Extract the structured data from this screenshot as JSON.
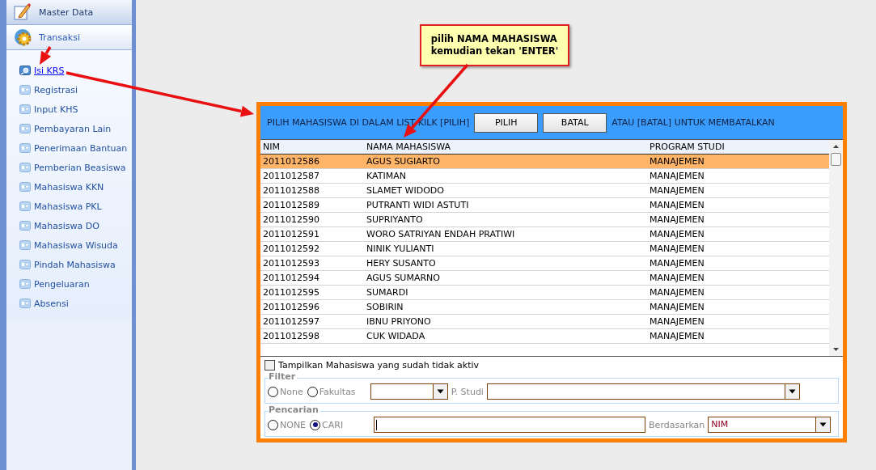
{
  "sidebar": {
    "groups": [
      {
        "label": "Master Data",
        "expanded": false
      },
      {
        "label": "Transaksi",
        "expanded": true
      }
    ],
    "items": [
      {
        "label": "Isi KRS",
        "selected": true
      },
      {
        "label": "Registrasi",
        "selected": false
      },
      {
        "label": "Input KHS",
        "selected": false
      },
      {
        "label": "Pembayaran Lain",
        "selected": false
      },
      {
        "label": "Penerimaan Bantuan",
        "selected": false
      },
      {
        "label": "Pemberian Beasiswa",
        "selected": false
      },
      {
        "label": "Mahasiswa KKN",
        "selected": false
      },
      {
        "label": "Mahasiswa PKL",
        "selected": false
      },
      {
        "label": "Mahasiswa DO",
        "selected": false
      },
      {
        "label": "Mahasiswa Wisuda",
        "selected": false
      },
      {
        "label": "Pindah Mahasiswa",
        "selected": false
      },
      {
        "label": "Pengeluaran",
        "selected": false
      },
      {
        "label": "Absensi",
        "selected": false
      }
    ]
  },
  "callout": {
    "lines": [
      "pilih NAMA MAHASISWA",
      "kemudian tekan 'ENTER'"
    ]
  },
  "dialog": {
    "instruction_left": "PILIH MAHASISWA DI DALAM LIST KILK [PILIH]",
    "buttons": [
      "PILIH",
      "BATAL"
    ],
    "instruction_right": "ATAU [BATAL] UNTUK MEMBATALKAN",
    "table": {
      "columns": [
        "NIM",
        "NAMA MAHASISWA",
        "PROGRAM STUDI"
      ],
      "rows": [
        {
          "cells": [
            "2011012586",
            "AGUS SUGIARTO",
            "MANAJEMEN"
          ],
          "selected": true
        },
        {
          "cells": [
            "2011012587",
            "KATIMAN",
            "MANAJEMEN"
          ],
          "selected": false
        },
        {
          "cells": [
            "2011012588",
            "SLAMET WIDODO",
            "MANAJEMEN"
          ],
          "selected": false
        },
        {
          "cells": [
            "2011012589",
            "PUTRANTI WIDI ASTUTI",
            "MANAJEMEN"
          ],
          "selected": false
        },
        {
          "cells": [
            "2011012590",
            "SUPRIYANTO",
            "MANAJEMEN"
          ],
          "selected": false
        },
        {
          "cells": [
            "2011012591",
            "WORO SATRIYAN ENDAH PRATIWI",
            "MANAJEMEN"
          ],
          "selected": false
        },
        {
          "cells": [
            "2011012592",
            "NINIK YULIANTI",
            "MANAJEMEN"
          ],
          "selected": false
        },
        {
          "cells": [
            "2011012593",
            "HERY SUSANTO",
            "MANAJEMEN"
          ],
          "selected": false
        },
        {
          "cells": [
            "2011012594",
            "AGUS SUMARNO",
            "MANAJEMEN"
          ],
          "selected": false
        },
        {
          "cells": [
            "2011012595",
            "SUMARDI",
            "MANAJEMEN"
          ],
          "selected": false
        },
        {
          "cells": [
            "2011012596",
            "SOBIRIN",
            "MANAJEMEN"
          ],
          "selected": false
        },
        {
          "cells": [
            "2011012597",
            "IBNU PRIYONO",
            "MANAJEMEN"
          ],
          "selected": false
        },
        {
          "cells": [
            "2011012598",
            "CUK WIDADA",
            "MANAJEMEN"
          ],
          "selected": false
        }
      ]
    },
    "inactive_checkbox": {
      "label": "Tampilkan Mahasiswa yang sudah tidak aktiv",
      "checked": false
    },
    "filter": {
      "legend": "Filter",
      "radios": [
        {
          "label": "None",
          "selected": false
        },
        {
          "label": "Fakultas",
          "selected": false
        }
      ],
      "fakultas_label": "P. Studi"
    },
    "search": {
      "legend": "Pencarian",
      "radios": [
        {
          "label": "NONE",
          "selected": false
        },
        {
          "label": "CARI",
          "selected": true
        }
      ],
      "by_label": "Berdasarkan",
      "by_value": "NIM"
    }
  }
}
